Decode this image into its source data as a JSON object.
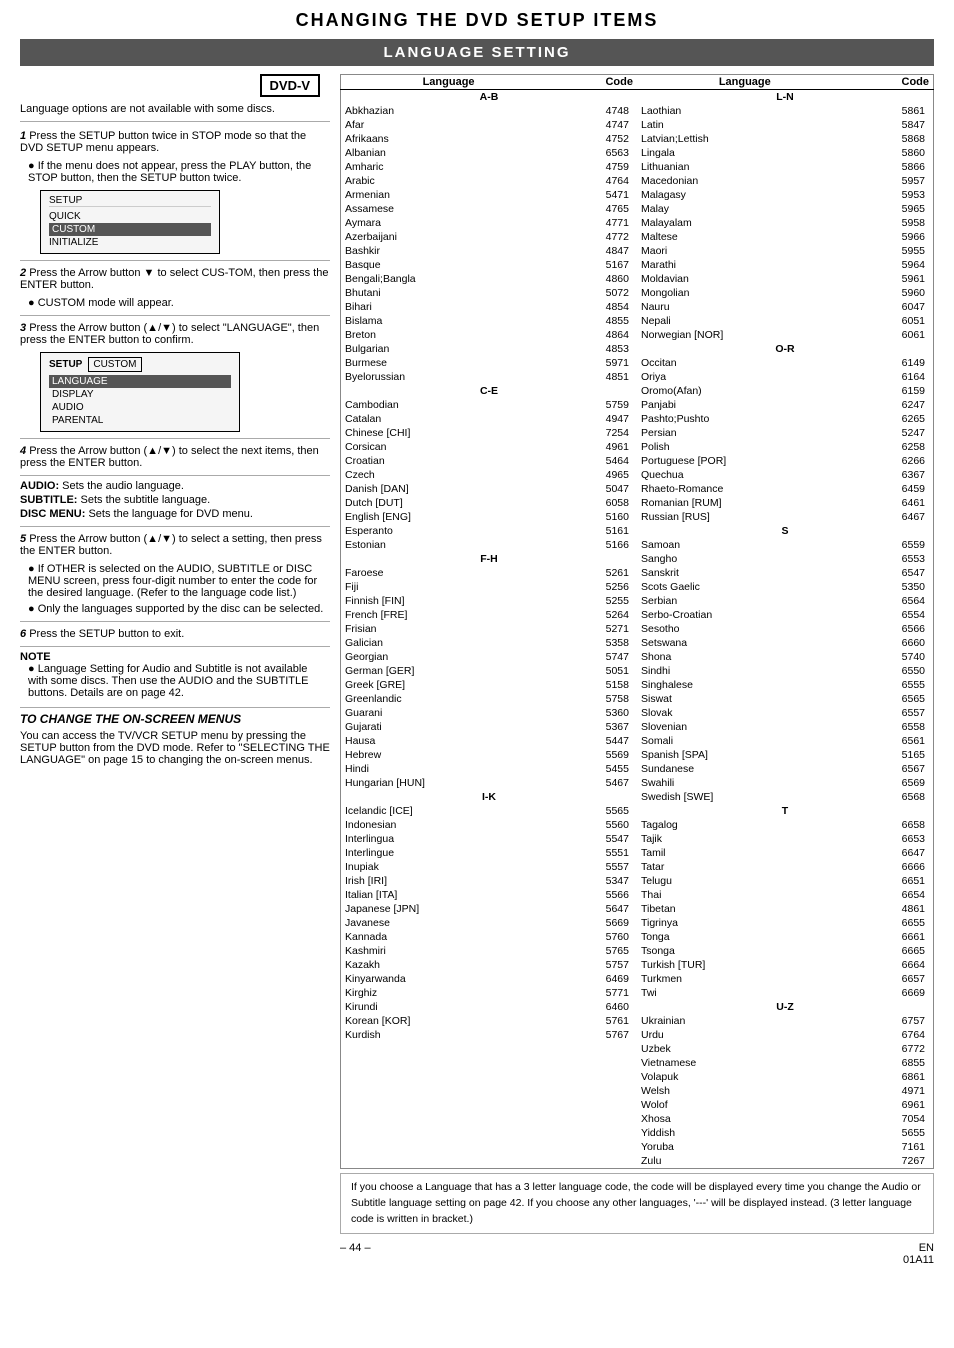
{
  "main_title": "CHANGING THE DVD SETUP ITEMS",
  "subtitle": "LANGUAGE SETTING",
  "dvd_badge": "DVD-V",
  "intro_text": "Language options are not available with some discs.",
  "steps": [
    {
      "num": "1",
      "text": "Press the SETUP button twice in STOP mode so that the DVD SETUP menu appears.",
      "bullet": "If the menu does not appear, press the PLAY button, the STOP button, then the SETUP button twice."
    },
    {
      "num": "2",
      "text": "Press the Arrow button ▼ to select CUS-TOM, then press the ENTER button.",
      "bullet": "CUSTOM mode will appear."
    },
    {
      "num": "3",
      "text": "Press the Arrow button (▲/▼) to select \"LANGUAGE\", then press the ENTER button to confirm."
    },
    {
      "num": "4",
      "text": "Press the Arrow button (▲/▼) to select the next items, then press the ENTER button."
    },
    {
      "num": "5",
      "text": "Press the Arrow button (▲/▼) to select a setting, then press the ENTER button.",
      "bullets": [
        "If OTHER is selected on the AUDIO, SUBTITLE or DISC MENU screen, press four-digit number to enter the code for the desired language. (Refer to the language code list.)",
        "Only the languages supported by the disc can be selected."
      ]
    },
    {
      "num": "6",
      "text": "Press the SETUP button to exit."
    }
  ],
  "setup_menu1": {
    "title": "SETUP",
    "items": [
      "QUICK",
      "CUSTOM",
      "INITIALIZE"
    ]
  },
  "setup_menu2": {
    "label": "SETUP",
    "value": "CUSTOM",
    "items": [
      "LANGUAGE",
      "DISPLAY",
      "AUDIO",
      "PARENTAL"
    ]
  },
  "audio_info": [
    "AUDIO: Sets the audio language.",
    "SUBTITLE: Sets the subtitle language.",
    "DISC MENU: Sets the language for DVD menu."
  ],
  "note_title": "NOTE",
  "note_bullets": [
    "Language Setting for Audio and Subtitle is not available with some discs. Then use the AUDIO and the SUBTITLE buttons. Details are on page 42."
  ],
  "on_screen_title": "TO CHANGE THE ON-SCREEN MENUS",
  "on_screen_text": "You can access the TV/VCR SETUP menu by pressing the SETUP button from the DVD mode. Refer to \"SELECTING THE LANGUAGE\" on page 15 to changing the on-screen menus.",
  "table_headers": [
    "Language",
    "Code",
    "Language",
    "Code"
  ],
  "lang_data_left": [
    {
      "section": "A-B"
    },
    {
      "lang": "Abkhazian",
      "code": "4748"
    },
    {
      "lang": "Afar",
      "code": "4747"
    },
    {
      "lang": "Afrikaans",
      "code": "4752"
    },
    {
      "lang": "Albanian",
      "code": "6563"
    },
    {
      "lang": "Amharic",
      "code": "4759"
    },
    {
      "lang": "Arabic",
      "code": "4764"
    },
    {
      "lang": "Armenian",
      "code": "5471"
    },
    {
      "lang": "Assamese",
      "code": "4765"
    },
    {
      "lang": "Aymara",
      "code": "4771"
    },
    {
      "lang": "Azerbaijani",
      "code": "4772"
    },
    {
      "lang": "Bashkir",
      "code": "4847"
    },
    {
      "lang": "Basque",
      "code": "5167"
    },
    {
      "lang": "Bengali;Bangla",
      "code": "4860"
    },
    {
      "lang": "Bhutani",
      "code": "5072"
    },
    {
      "lang": "Bihari",
      "code": "4854"
    },
    {
      "lang": "Bislama",
      "code": "4855"
    },
    {
      "lang": "Breton",
      "code": "4864"
    },
    {
      "lang": "Bulgarian",
      "code": "4853"
    },
    {
      "lang": "Burmese",
      "code": "5971"
    },
    {
      "lang": "Byelorussian",
      "code": "4851"
    },
    {
      "section": "C-E"
    },
    {
      "lang": "Cambodian",
      "code": "5759"
    },
    {
      "lang": "Catalan",
      "code": "4947"
    },
    {
      "lang": "Chinese [CHI]",
      "code": "7254"
    },
    {
      "lang": "Corsican",
      "code": "4961"
    },
    {
      "lang": "Croatian",
      "code": "5464"
    },
    {
      "lang": "Czech",
      "code": "4965"
    },
    {
      "lang": "Danish [DAN]",
      "code": "5047"
    },
    {
      "lang": "Dutch [DUT]",
      "code": "6058"
    },
    {
      "lang": "English [ENG]",
      "code": "5160"
    },
    {
      "lang": "Esperanto",
      "code": "5161"
    },
    {
      "lang": "Estonian",
      "code": "5166"
    },
    {
      "section": "F-H"
    },
    {
      "lang": "Faroese",
      "code": "5261"
    },
    {
      "lang": "Fiji",
      "code": "5256"
    },
    {
      "lang": "Finnish [FIN]",
      "code": "5255"
    },
    {
      "lang": "French [FRE]",
      "code": "5264"
    },
    {
      "lang": "Frisian",
      "code": "5271"
    },
    {
      "lang": "Galician",
      "code": "5358"
    },
    {
      "lang": "Georgian",
      "code": "5747"
    },
    {
      "lang": "German [GER]",
      "code": "5051"
    },
    {
      "lang": "Greek [GRE]",
      "code": "5158"
    },
    {
      "lang": "Greenlandic",
      "code": "5758"
    },
    {
      "lang": "Guarani",
      "code": "5360"
    },
    {
      "lang": "Gujarati",
      "code": "5367"
    },
    {
      "lang": "Hausa",
      "code": "5447"
    },
    {
      "lang": "Hebrew",
      "code": "5569"
    },
    {
      "lang": "Hindi",
      "code": "5455"
    },
    {
      "lang": "Hungarian [HUN]",
      "code": "5467"
    },
    {
      "section": "I-K"
    },
    {
      "lang": "Icelandic [ICE]",
      "code": "5565"
    },
    {
      "lang": "Indonesian",
      "code": "5560"
    },
    {
      "lang": "Interlingua",
      "code": "5547"
    },
    {
      "lang": "Interlingue",
      "code": "5551"
    },
    {
      "lang": "Inupiak",
      "code": "5557"
    },
    {
      "lang": "Irish [IRI]",
      "code": "5347"
    },
    {
      "lang": "Italian [ITA]",
      "code": "5566"
    },
    {
      "lang": "Japanese [JPN]",
      "code": "5647"
    },
    {
      "lang": "Javanese",
      "code": "5669"
    },
    {
      "lang": "Kannada",
      "code": "5760"
    },
    {
      "lang": "Kashmiri",
      "code": "5765"
    },
    {
      "lang": "Kazakh",
      "code": "5757"
    },
    {
      "lang": "Kinyarwanda",
      "code": "6469"
    },
    {
      "lang": "Kirghiz",
      "code": "5771"
    },
    {
      "lang": "Kirundi",
      "code": "6460"
    },
    {
      "lang": "Korean [KOR]",
      "code": "5761"
    },
    {
      "lang": "Kurdish",
      "code": "5767"
    }
  ],
  "lang_data_right": [
    {
      "section": "L-N"
    },
    {
      "lang": "Laothian",
      "code": "5861"
    },
    {
      "lang": "Latin",
      "code": "5847"
    },
    {
      "lang": "Latvian;Lettish",
      "code": "5868"
    },
    {
      "lang": "Lingala",
      "code": "5860"
    },
    {
      "lang": "Lithuanian",
      "code": "5866"
    },
    {
      "lang": "Macedonian",
      "code": "5957"
    },
    {
      "lang": "Malagasy",
      "code": "5953"
    },
    {
      "lang": "Malay",
      "code": "5965"
    },
    {
      "lang": "Malayalam",
      "code": "5958"
    },
    {
      "lang": "Maltese",
      "code": "5966"
    },
    {
      "lang": "Maori",
      "code": "5955"
    },
    {
      "lang": "Marathi",
      "code": "5964"
    },
    {
      "lang": "Moldavian",
      "code": "5961"
    },
    {
      "lang": "Mongolian",
      "code": "5960"
    },
    {
      "lang": "Nauru",
      "code": "6047"
    },
    {
      "lang": "Nepali",
      "code": "6051"
    },
    {
      "lang": "Norwegian [NOR]",
      "code": "6061"
    },
    {
      "section": "O-R"
    },
    {
      "lang": "Occitan",
      "code": "6149"
    },
    {
      "lang": "Oriya",
      "code": "6164"
    },
    {
      "lang": "Oromo(Afan)",
      "code": "6159"
    },
    {
      "lang": "Panjabi",
      "code": "6247"
    },
    {
      "lang": "Pashto;Pushto",
      "code": "6265"
    },
    {
      "lang": "Persian",
      "code": "5247"
    },
    {
      "lang": "Polish",
      "code": "6258"
    },
    {
      "lang": "Portuguese [POR]",
      "code": "6266"
    },
    {
      "lang": "Quechua",
      "code": "6367"
    },
    {
      "lang": "Rhaeto-Romance",
      "code": "6459"
    },
    {
      "lang": "Romanian [RUM]",
      "code": "6461"
    },
    {
      "lang": "Russian [RUS]",
      "code": "6467"
    },
    {
      "section": "S"
    },
    {
      "lang": "Samoan",
      "code": "6559"
    },
    {
      "lang": "Sangho",
      "code": "6553"
    },
    {
      "lang": "Sanskrit",
      "code": "6547"
    },
    {
      "lang": "Scots Gaelic",
      "code": "5350"
    },
    {
      "lang": "Serbian",
      "code": "6564"
    },
    {
      "lang": "Serbo-Croatian",
      "code": "6554"
    },
    {
      "lang": "Sesotho",
      "code": "6566"
    },
    {
      "lang": "Setswana",
      "code": "6660"
    },
    {
      "lang": "Shona",
      "code": "5740"
    },
    {
      "lang": "Sindhi",
      "code": "6550"
    },
    {
      "lang": "Singhalese",
      "code": "6555"
    },
    {
      "lang": "Siswat",
      "code": "6565"
    },
    {
      "lang": "Slovak",
      "code": "6557"
    },
    {
      "lang": "Slovenian",
      "code": "6558"
    },
    {
      "lang": "Somali",
      "code": "6561"
    },
    {
      "lang": "Spanish [SPA]",
      "code": "5165"
    },
    {
      "lang": "Sundanese",
      "code": "6567"
    },
    {
      "lang": "Swahili",
      "code": "6569"
    },
    {
      "lang": "Swedish [SWE]",
      "code": "6568"
    },
    {
      "section": "T"
    },
    {
      "lang": "Tagalog",
      "code": "6658"
    },
    {
      "lang": "Tajik",
      "code": "6653"
    },
    {
      "lang": "Tamil",
      "code": "6647"
    },
    {
      "lang": "Tatar",
      "code": "6666"
    },
    {
      "lang": "Telugu",
      "code": "6651"
    },
    {
      "lang": "Thai",
      "code": "6654"
    },
    {
      "lang": "Tibetan",
      "code": "4861"
    },
    {
      "lang": "Tigrinya",
      "code": "6655"
    },
    {
      "lang": "Tonga",
      "code": "6661"
    },
    {
      "lang": "Tsonga",
      "code": "6665"
    },
    {
      "lang": "Turkish [TUR]",
      "code": "6664"
    },
    {
      "lang": "Turkmen",
      "code": "6657"
    },
    {
      "lang": "Twi",
      "code": "6669"
    },
    {
      "section": "U-Z"
    },
    {
      "lang": "Ukrainian",
      "code": "6757"
    },
    {
      "lang": "Urdu",
      "code": "6764"
    },
    {
      "lang": "Uzbek",
      "code": "6772"
    },
    {
      "lang": "Vietnamese",
      "code": "6855"
    },
    {
      "lang": "Volapuk",
      "code": "6861"
    },
    {
      "lang": "Welsh",
      "code": "4971"
    },
    {
      "lang": "Wolof",
      "code": "6961"
    },
    {
      "lang": "Xhosa",
      "code": "7054"
    },
    {
      "lang": "Yiddish",
      "code": "5655"
    },
    {
      "lang": "Yoruba",
      "code": "7161"
    },
    {
      "lang": "Zulu",
      "code": "7267"
    }
  ],
  "bottom_note": "If you choose a Language that has a 3 letter language code, the code will be displayed every time you change the Audio or Subtitle language setting on page 42. If you choose any other languages, '---' will be displayed instead. (3 letter language code is written in bracket.)",
  "footer_page": "– 44 –",
  "footer_code": "EN\n01A11"
}
